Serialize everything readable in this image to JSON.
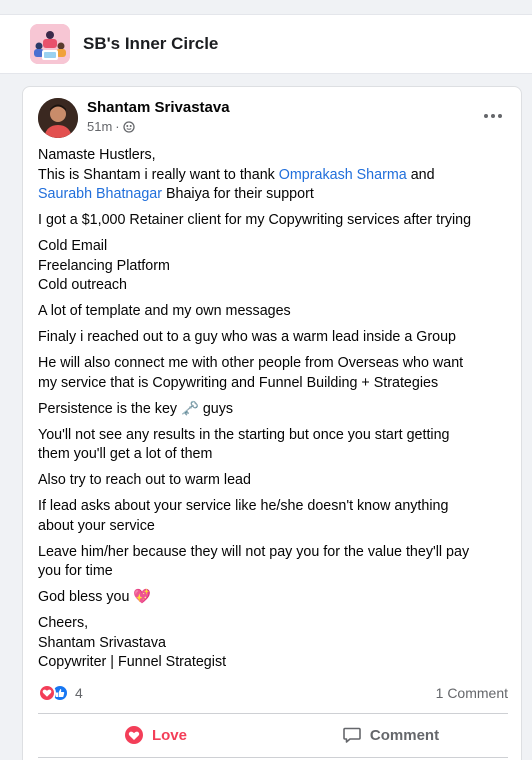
{
  "group": {
    "name": "SB's Inner Circle"
  },
  "post": {
    "author": "Shantam Srivastava",
    "time": "51m",
    "meta_separator": "·",
    "body": {
      "p1_line1": "Namaste Hustlers,",
      "p1_line2_pre": "This is Shantam i really want to thank ",
      "mention1": "Omprakash Sharma",
      "p1_line2_mid": "  and",
      "mention2": "Saurabh Bhatnagar",
      "p1_line3_post": "  Bhaiya for their support",
      "p2": "I got a $1,000 Retainer client for my Copywriting services after trying",
      "p3_line1": "Cold Email",
      "p3_line2": "Freelancing Platform",
      "p3_line3": "Cold outreach",
      "p4": "A lot of template and my own messages",
      "p5": "Finaly i reached out to a guy who was a warm lead inside a Group",
      "p6_line1": "He will also connect me with other people from Overseas who want",
      "p6_line2": "my service that is Copywriting and Funnel Building + Strategies",
      "p7_pre": "Persistence is the key ",
      "p7_emoji": "🗝️",
      "p7_post": " guys",
      "p8_line1": "You'll not see any results in the starting but once you start getting",
      "p8_line2": "them you'll get a lot of them",
      "p9": "Also try to reach out to warm lead",
      "p10_line1": "If lead asks about your service like he/she doesn't know anything",
      "p10_line2": "about your service",
      "p11_line1": "Leave him/her because they will not pay you for the value they'll pay",
      "p11_line2": "you for time",
      "p12_pre": "God bless you ",
      "p12_emoji": "💖",
      "p13_line1": "Cheers,",
      "p13_line2": "Shantam Srivastava",
      "p13_line3": "Copywriter | Funnel Strategist"
    },
    "reactions": {
      "icons": [
        "love-reaction-icon",
        "like-reaction-icon"
      ],
      "count": "4",
      "comments": "1 Comment"
    },
    "actions": {
      "love": "Love",
      "comment": "Comment"
    }
  },
  "colors": {
    "mention": "#216fdb",
    "love": "#f33e58",
    "like": "#1877f2",
    "muted": "#65676b"
  }
}
